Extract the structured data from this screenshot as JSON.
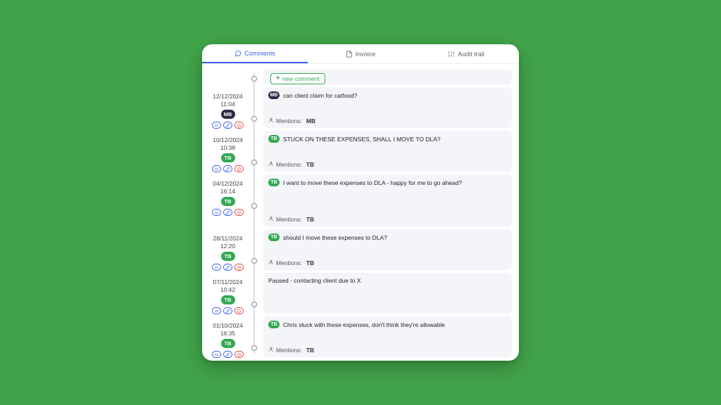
{
  "tabs": {
    "comments": "Comments",
    "invoice": "Invoice",
    "audit": "Audit trail"
  },
  "newComment": "new comment",
  "mentionsLabel": "Mentions:",
  "comments": [
    {
      "date": "12/12/2024",
      "time": "11:04",
      "authorInitials": "MB",
      "authorType": "mb",
      "text": "can client claim for catfood?",
      "mentions": "MB",
      "system": false
    },
    {
      "date": "10/12/2024",
      "time": "10:38",
      "authorInitials": "TB",
      "authorType": "tb",
      "text": "STUCK ON THESE EXPENSES, SHALL I MOVE TO DLA?",
      "mentions": "TB",
      "system": false
    },
    {
      "date": "04/12/2024",
      "time": "16:14",
      "authorInitials": "TB",
      "authorType": "tb",
      "text": "I want to move these expenses to DLA - happy for me to go ahead?",
      "mentions": "TB",
      "system": false,
      "tall": true
    },
    {
      "date": "28/11/2024",
      "time": "12:20",
      "authorInitials": "TB",
      "authorType": "tb",
      "text": "should I move these expenses to DLA?",
      "mentions": "TB",
      "system": false
    },
    {
      "date": "07/11/2024",
      "time": "10:42",
      "authorInitials": "TB",
      "authorType": "tb",
      "text": "Paused - contacting client due to X",
      "mentions": "",
      "system": true
    },
    {
      "date": "01/10/2024",
      "time": "16:35",
      "authorInitials": "TB",
      "authorType": "tb",
      "text": "Chris stuck with these expenses, don't think they're allowable",
      "mentions": "TB",
      "system": false
    }
  ]
}
